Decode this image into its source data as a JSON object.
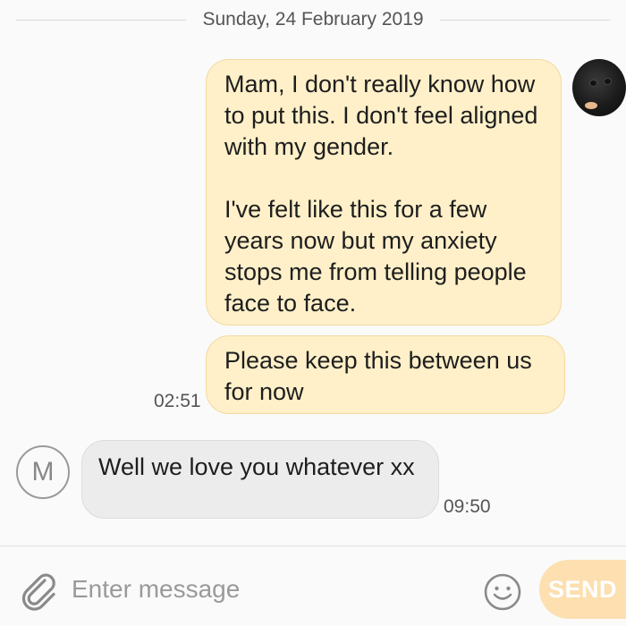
{
  "conversation": {
    "date_divider": "Sunday, 24 February 2019",
    "messages": [
      {
        "direction": "sent",
        "text": "Mam, I don't really know how to put this. I don't feel aligned with my gender.\n\nI've felt like this for a few years now but my anxiety stops me from telling people face to face."
      },
      {
        "direction": "sent",
        "text": "Please keep this between us for now",
        "time": "02:51"
      },
      {
        "direction": "received",
        "text": "Well we love you whatever xx",
        "time": "09:50"
      }
    ],
    "contact_initial": "M"
  },
  "composer": {
    "placeholder": "Enter message",
    "send_label": "SEND"
  },
  "colors": {
    "sent_bubble": "#fff0c9",
    "received_bubble": "#ececec",
    "send_button": "#fddfb0"
  },
  "icons": {
    "attach": "paperclip-icon",
    "emoji": "emoji-icon"
  }
}
